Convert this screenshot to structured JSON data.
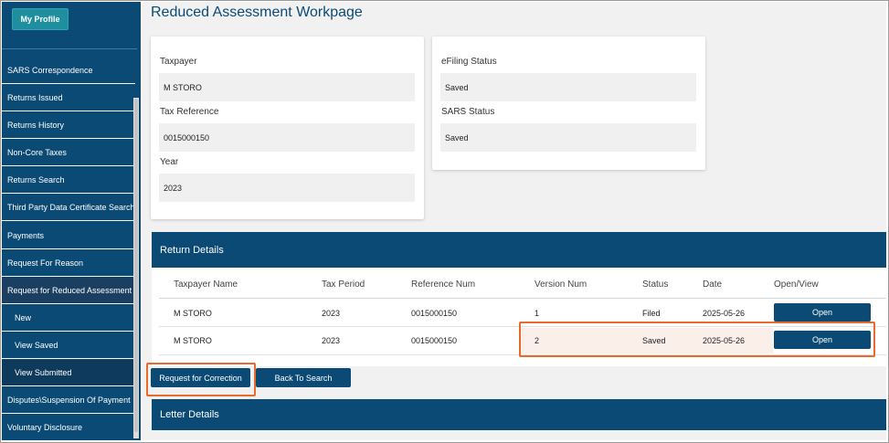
{
  "sidebar": {
    "profile_label": "My Profile",
    "items": [
      {
        "label": "SARS Correspondence"
      },
      {
        "label": "Returns Issued"
      },
      {
        "label": "Returns History"
      },
      {
        "label": "Non-Core Taxes"
      },
      {
        "label": "Returns Search"
      },
      {
        "label": "Third Party Data Certificate Search"
      },
      {
        "label": "Payments"
      },
      {
        "label": "Request For Reason"
      },
      {
        "label": "Request for Reduced Assessment"
      },
      {
        "label": "New"
      },
      {
        "label": "View Saved"
      },
      {
        "label": "View Submitted"
      },
      {
        "label": "Disputes\\Suspension Of Payment"
      },
      {
        "label": "Voluntary Disclosure"
      }
    ]
  },
  "page": {
    "title": "Reduced Assessment Workpage"
  },
  "summary": {
    "taxpayer_label": "Taxpayer",
    "taxpayer_value": "M STORO",
    "tax_ref_label": "Tax Reference",
    "tax_ref_value": "0015000150",
    "year_label": "Year",
    "year_value": "2023",
    "efiling_status_label": "eFiling Status",
    "efiling_status_value": "Saved",
    "sars_status_label": "SARS Status",
    "sars_status_value": "Saved"
  },
  "return_details": {
    "title": "Return Details",
    "columns": [
      "Taxpayer Name",
      "Tax Period",
      "Reference Num",
      "Version Num",
      "Status",
      "Date",
      "Open/View"
    ],
    "rows": [
      {
        "name": "M STORO",
        "period": "2023",
        "ref": "0015000150",
        "version": "1",
        "status": "Filed",
        "date": "2025-05-26",
        "action": "Open"
      },
      {
        "name": "M STORO",
        "period": "2023",
        "ref": "0015000150",
        "version": "2",
        "status": "Saved",
        "date": "2025-05-26",
        "action": "Open"
      }
    ]
  },
  "actions": {
    "request_correction": "Request for Correction",
    "back_to_search": "Back To Search"
  },
  "letter_details": {
    "title": "Letter Details"
  },
  "colors": {
    "primary": "#0b4a74",
    "highlight": "#e86a2c"
  }
}
